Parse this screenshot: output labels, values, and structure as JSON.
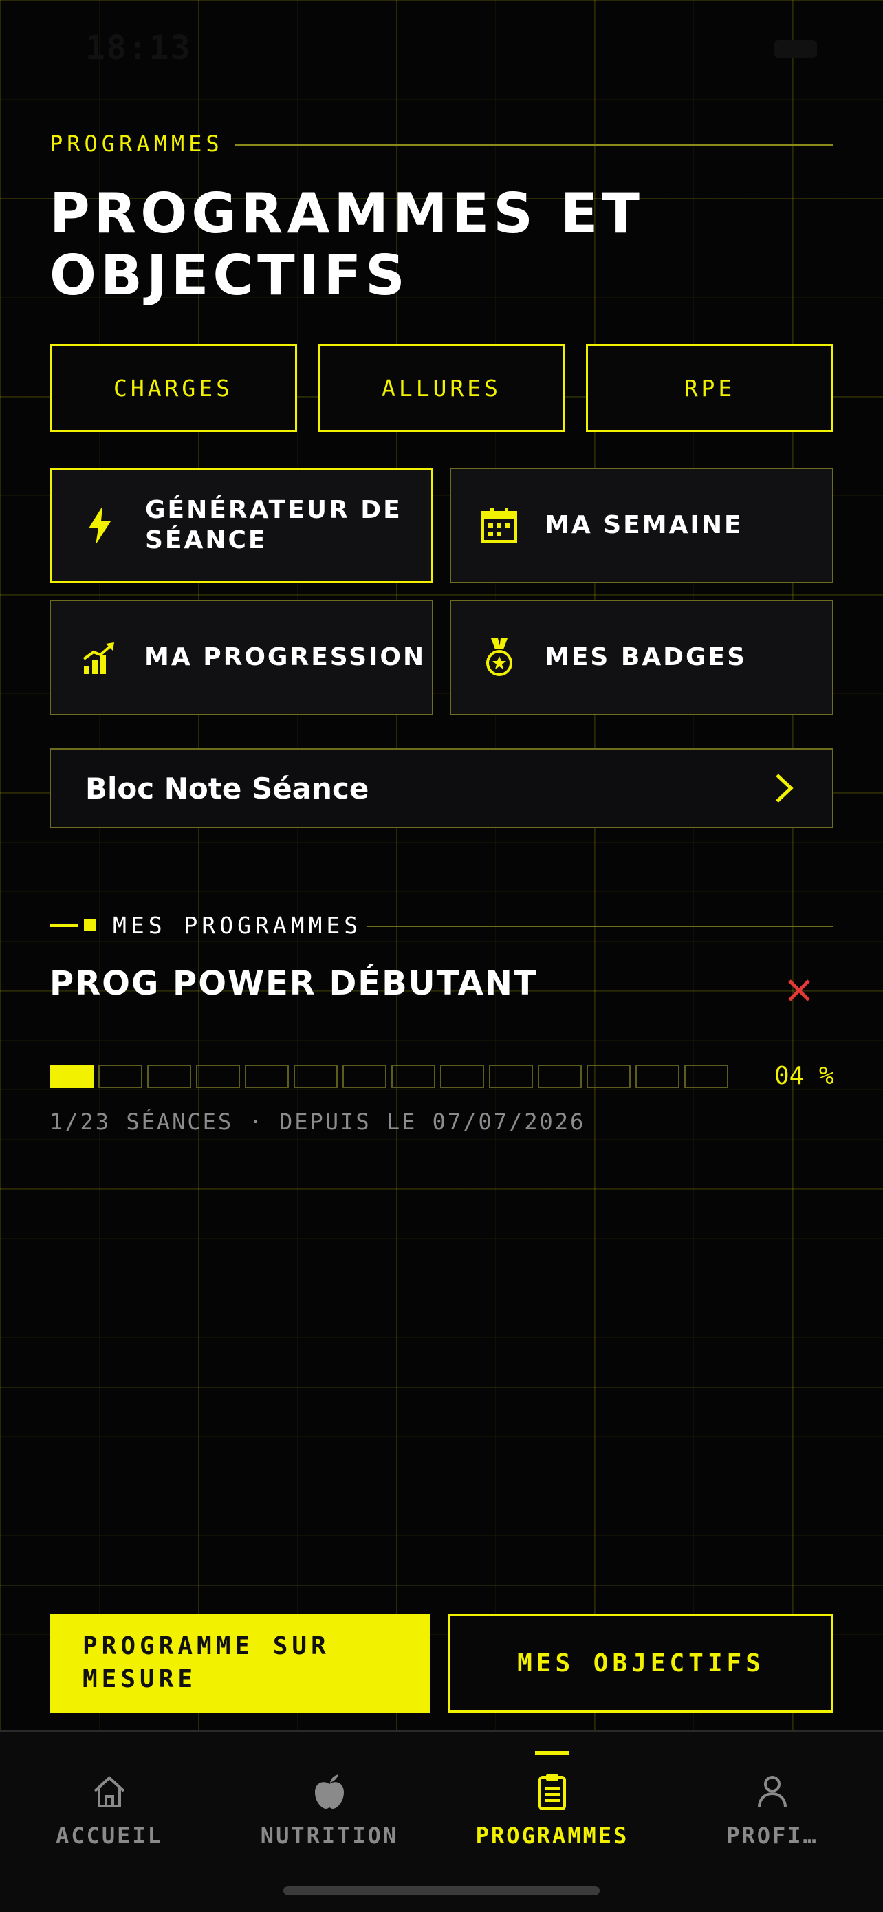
{
  "status_bar": {
    "time": "18:13"
  },
  "header": {
    "eyebrow": "PROGRAMMES",
    "title": "PROGRAMMES ET OBJECTIFS"
  },
  "unit_tabs": [
    {
      "label": "CHARGES"
    },
    {
      "label": "ALLURES"
    },
    {
      "label": "RPE"
    }
  ],
  "features": [
    {
      "label": "GÉNÉRATEUR DE SÉANCE",
      "icon": "lightning-icon"
    },
    {
      "label": "MA SEMAINE",
      "icon": "calendar-icon"
    },
    {
      "label": "MA PROGRESSION",
      "icon": "chart-up-icon"
    },
    {
      "label": "MES BADGES",
      "icon": "medal-icon"
    }
  ],
  "note": {
    "label": "Bloc Note Séance"
  },
  "programs_section": {
    "label": "MES PROGRAMMES",
    "program": {
      "title": "PROG POWER DÉBUTANT",
      "progress_fraction": 0.04,
      "segments_total": 14,
      "segments_filled": 1,
      "percent_label": "04 %",
      "meta": "1/23 SÉANCES · DEPUIS LE 07/07/2026"
    }
  },
  "cta": {
    "primary": "PROGRAMME SUR MESURE",
    "secondary": "MES OBJECTIFS"
  },
  "tabbar": {
    "items": [
      {
        "label": "ACCUEIL",
        "icon": "home-icon"
      },
      {
        "label": "NUTRITION",
        "icon": "apple-icon"
      },
      {
        "label": "PROGRAMMES",
        "icon": "clipboard-icon",
        "active": true
      },
      {
        "label": "PROFI…",
        "icon": "user-icon"
      }
    ]
  },
  "colors": {
    "accent": "#F2F200",
    "background": "#050505",
    "danger": "#E53935"
  }
}
